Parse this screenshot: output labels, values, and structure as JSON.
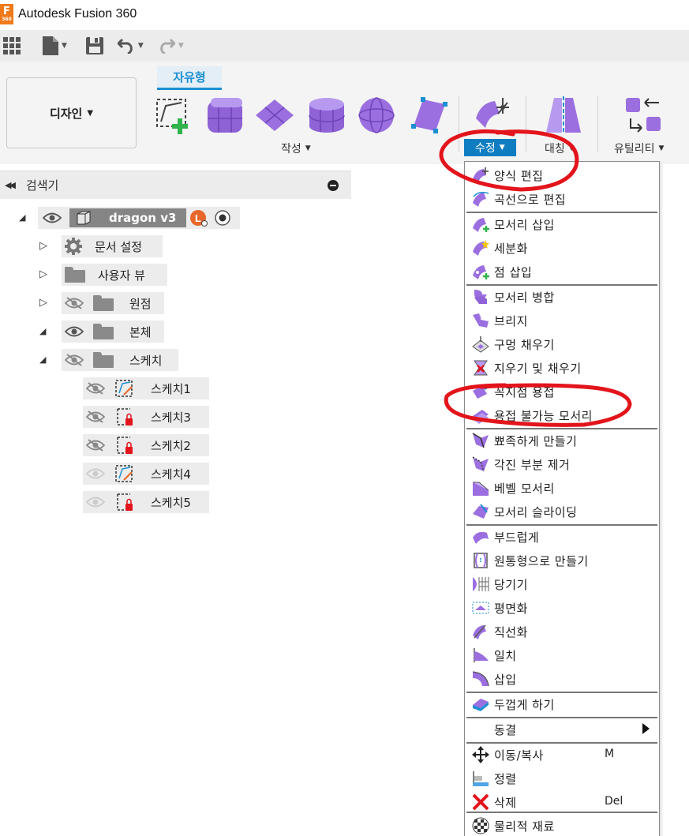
{
  "window": {
    "title": "Autodesk Fusion 360",
    "logo_top": "F",
    "logo_bottom": "360"
  },
  "ribbon": {
    "workspace_label": "디자인",
    "active_tab": "자유형",
    "groups": {
      "create": "작성",
      "modify": "수정",
      "symmetry": "대칭",
      "utility": "유틸리티"
    }
  },
  "browser": {
    "title": "검색기",
    "root_label": "dragon v3",
    "items": [
      {
        "label": "문서 설정"
      },
      {
        "label": "사용자 뷰"
      },
      {
        "label": "원점"
      },
      {
        "label": "본체"
      },
      {
        "label": "스케치"
      }
    ],
    "sketches": [
      {
        "label": "스케치1"
      },
      {
        "label": "스케치3"
      },
      {
        "label": "스케치2"
      },
      {
        "label": "스케치4"
      },
      {
        "label": "스케치5"
      }
    ]
  },
  "modify_menu": {
    "items": [
      {
        "label": "양식 편집",
        "icon": "edit-form-icon"
      },
      {
        "label": "곡선으로 편집",
        "icon": "edit-by-curve-icon"
      },
      {
        "label": "모서리 삽입",
        "icon": "insert-edge-icon"
      },
      {
        "label": "세분화",
        "icon": "subdivide-icon"
      },
      {
        "label": "점 삽입",
        "icon": "insert-point-icon"
      },
      {
        "label": "모서리 병합",
        "icon": "merge-edge-icon"
      },
      {
        "label": "브리지",
        "icon": "bridge-icon"
      },
      {
        "label": "구멍 채우기",
        "icon": "fill-hole-icon"
      },
      {
        "label": "지우기 및 채우기",
        "icon": "erase-and-fill-icon"
      },
      {
        "label": "꼭지점 용접",
        "icon": "weld-vertices-icon"
      },
      {
        "label": "용접 불가능 모서리",
        "icon": "unweld-edges-icon"
      },
      {
        "label": "뾰족하게 만들기",
        "icon": "crease-icon"
      },
      {
        "label": "각진 부분 제거",
        "icon": "uncrease-icon"
      },
      {
        "label": "베벨 모서리",
        "icon": "bevel-edge-icon"
      },
      {
        "label": "모서리 슬라이딩",
        "icon": "slide-edge-icon"
      },
      {
        "label": "부드럽게",
        "icon": "smooth-icon"
      },
      {
        "label": "원통형으로 만들기",
        "icon": "cylindrify-icon"
      },
      {
        "label": "당기기",
        "icon": "pull-icon"
      },
      {
        "label": "평면화",
        "icon": "flatten-icon"
      },
      {
        "label": "직선화",
        "icon": "straighten-icon"
      },
      {
        "label": "일치",
        "icon": "match-icon"
      },
      {
        "label": "삽입",
        "icon": "interpolate-icon"
      },
      {
        "label": "두껍게 하기",
        "icon": "thicken-icon"
      },
      {
        "label": "동결",
        "icon": "freeze-icon"
      },
      {
        "label": "이동/복사",
        "icon": "move-copy-icon",
        "shortcut": "M"
      },
      {
        "label": "정렬",
        "icon": "align-icon"
      },
      {
        "label": "삭제",
        "icon": "delete-icon",
        "shortcut": "Del"
      },
      {
        "label": "물리적 재료",
        "icon": "physical-material-icon"
      }
    ]
  },
  "colors": {
    "accent_blue": "#1b8fd2",
    "modify_active": "#0f7dc2",
    "tool_purple": "#9b6fe0",
    "annotation_red": "#e3141b"
  }
}
